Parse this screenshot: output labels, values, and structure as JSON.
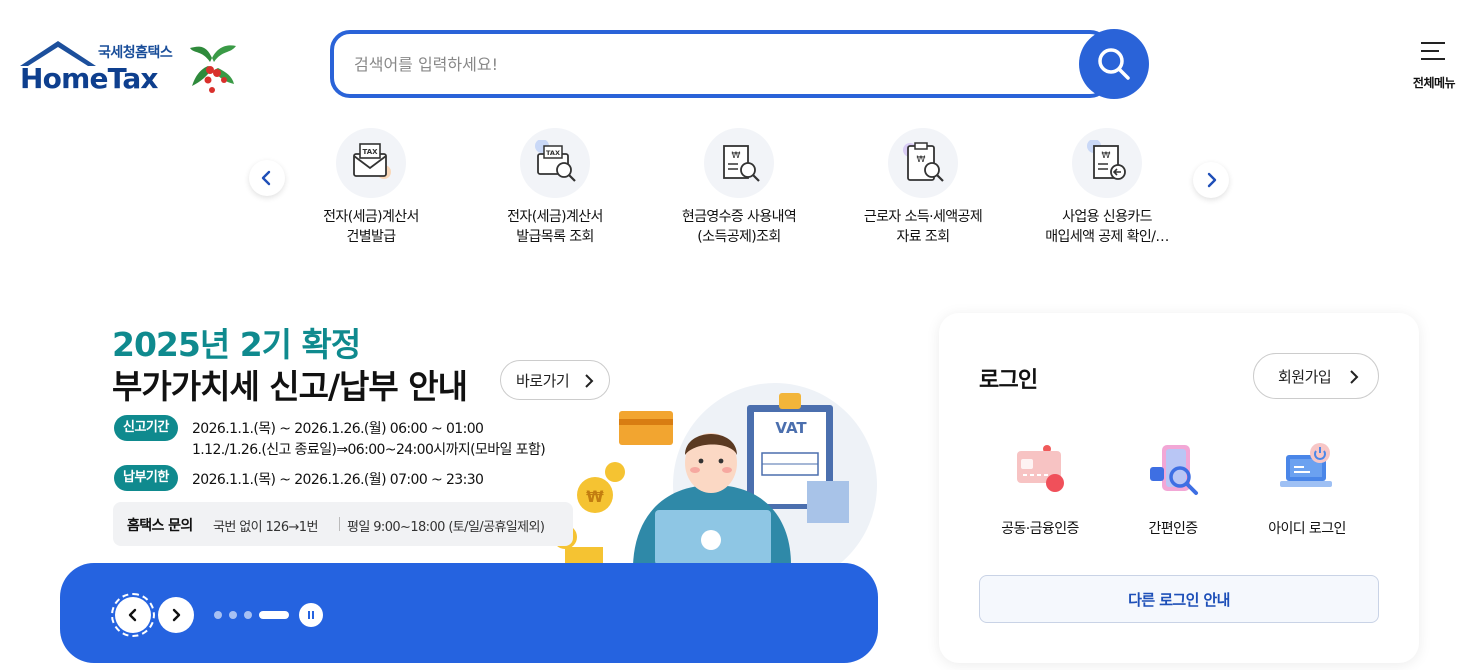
{
  "header": {
    "logo_sub": "국세청홈택스",
    "logo_main": "HomeTax",
    "search_placeholder": "검색어를 입력하세요!",
    "menu_label": "전체메뉴"
  },
  "quick_services": [
    {
      "line1": "전자(세금)계산서",
      "line2": "건별발급",
      "icon": "tax-envelope-icon"
    },
    {
      "line1": "전자(세금)계산서",
      "line2": "발급목록 조회",
      "icon": "tax-search-icon"
    },
    {
      "line1": "현금영수증 사용내역",
      "line2": "(소득공제)조회",
      "icon": "receipt-search-icon"
    },
    {
      "line1": "근로자 소득·세액공제",
      "line2": "자료 조회",
      "icon": "clipboard-search-icon"
    },
    {
      "line1": "사업용 신용카드",
      "line2": "매입세액 공제 확인/…",
      "icon": "card-receipt-icon"
    }
  ],
  "banner": {
    "title_line1": "2025년 2기 확정",
    "title_line2": "부가가치세 신고/납부 안내",
    "goto_label": "바로가기",
    "report_period_label": "신고기간",
    "report_period_line1": "2026.1.1.(목) ~ 2026.1.26.(월) 06:00 ~ 01:00",
    "report_period_line2": "1.12./1.26.(신고 종료일)⇒06:00~24:00시까지(모바일 포함)",
    "payment_deadline_label": "납부기한",
    "payment_deadline": "2026.1.1.(목) ~ 2026.1.26.(월) 07:00 ~ 23:30",
    "inquiry_title": "홈택스 문의",
    "inquiry_phone": "국번 없이 126→1번",
    "inquiry_hours": "평일 9:00~18:00 (토/일/공휴일제외)",
    "illust_vat": "VAT",
    "slide_count": 4,
    "active_slide": 4
  },
  "login": {
    "title": "로그인",
    "signup_label": "회원가입",
    "options": [
      {
        "label": "공동·금융인증",
        "icon": "certificate-card-icon"
      },
      {
        "label": "간편인증",
        "icon": "phone-search-icon"
      },
      {
        "label": "아이디 로그인",
        "icon": "laptop-power-icon"
      }
    ],
    "other_login_label": "다른 로그인 안내"
  },
  "colors": {
    "brand_blue": "#2563e0",
    "teal": "#0f8a8e",
    "logo_navy": "#0e3f8e"
  }
}
